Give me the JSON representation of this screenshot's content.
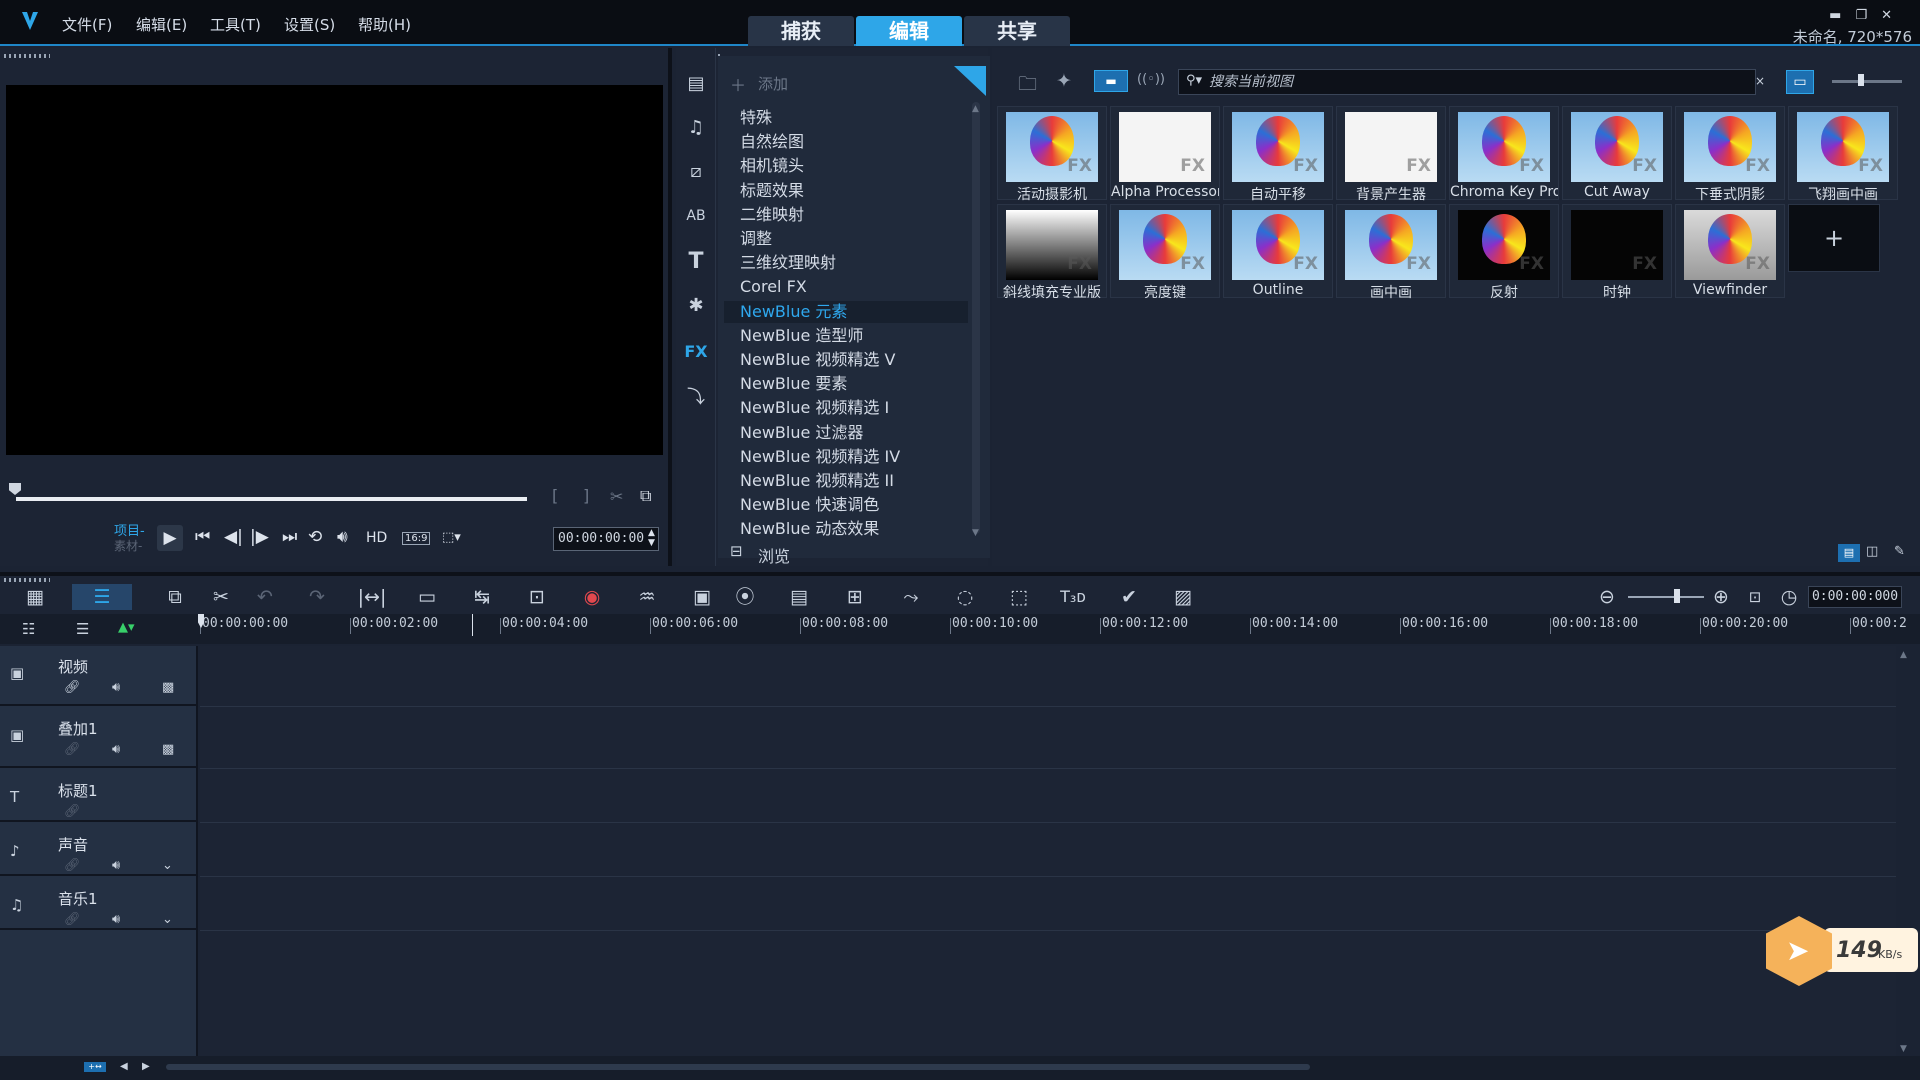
{
  "menu": {
    "file": "文件(F)",
    "edit": "编辑(E)",
    "tools": "工具(T)",
    "settings": "设置(S)",
    "help": "帮助(H)"
  },
  "modes": {
    "capture": "捕获",
    "edit": "编辑",
    "share": "共享"
  },
  "project_info": "未命名, 720*576",
  "preview": {
    "project_label": "项目-",
    "clip_label": "素材-",
    "hd": "HD",
    "aspect": "16:9",
    "timecode": "00:00:00:00"
  },
  "library": {
    "add_label": "添加",
    "browse_label": "浏览",
    "categories": [
      "特殊",
      "自然绘图",
      "相机镜头",
      "标题效果",
      "二维映射",
      "调整",
      "三维纹理映射",
      "Corel FX",
      "NewBlue 元素",
      "NewBlue 造型师",
      "NewBlue 视频精选 V",
      "NewBlue 要素",
      "NewBlue 视频精选 I",
      "NewBlue 过滤器",
      "NewBlue 视频精选 IV",
      "NewBlue 视频精选 II",
      "NewBlue 快速调色",
      "NewBlue 动态效果"
    ],
    "selected_category": "NewBlue 元素",
    "search_placeholder": "搜索当前视图",
    "fx_label": "FX",
    "effects": [
      "活动摄影机",
      "Alpha Processor",
      "自动平移",
      "背景产生器",
      "Chroma Key Pro",
      "Cut Away",
      "下垂式阴影",
      "飞翔画中画",
      "斜线填充专业版",
      "亮度键",
      "Outline",
      "画中画",
      "反射",
      "时钟",
      "Viewfinder"
    ]
  },
  "timeline": {
    "timecode": "0:00:00:000",
    "ruler": [
      "00:00:00:00",
      "00:00:02:00",
      "00:00:04:00",
      "00:00:06:00",
      "00:00:08:00",
      "00:00:10:00",
      "00:00:12:00",
      "00:00:14:00",
      "00:00:16:00",
      "00:00:18:00",
      "00:00:20:00",
      "00:00:2"
    ],
    "tracks": [
      {
        "name": "视频"
      },
      {
        "name": "叠加1"
      },
      {
        "name": "标题1"
      },
      {
        "name": "声音"
      },
      {
        "name": "音乐1"
      }
    ]
  },
  "speed": {
    "value": "149",
    "unit": "KB/s"
  },
  "colors": {
    "accent": "#2ea6e8",
    "panel": "#1c2434",
    "titlebar": "#0a0d13"
  }
}
